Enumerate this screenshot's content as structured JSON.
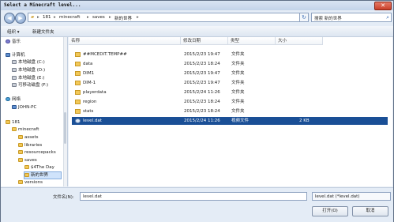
{
  "window": {
    "title": "Select a Minecraft level...",
    "close_glyph": "✕"
  },
  "address": {
    "back_glyph": "◀",
    "forward_glyph": "▶",
    "crumbs": [
      "181",
      "minecraft",
      "saves",
      "新的世界"
    ],
    "sep": "▸",
    "dropdown_glyph": "▾",
    "refresh_glyph": "↻",
    "search_placeholder": "搜索 新的世界",
    "search_glyph": "⌕"
  },
  "toolbar": {
    "organize": "组织 ▾",
    "new_folder": "新建文件夹"
  },
  "nav": {
    "items": [
      {
        "label": "音乐",
        "icon": "music-icon"
      },
      {
        "label": "计算机",
        "icon": "computer-icon"
      },
      {
        "label": "本地磁盘 (C:)",
        "icon": "drive-icon"
      },
      {
        "label": "本地磁盘 (D:)",
        "icon": "drive-icon"
      },
      {
        "label": "本地磁盘 (E:)",
        "icon": "drive-icon"
      },
      {
        "label": "可移动磁盘 (F:)",
        "icon": "drive-icon"
      },
      {
        "label": "网络",
        "icon": "network-icon"
      },
      {
        "label": "JOHN-PC",
        "icon": "computer-icon"
      },
      {
        "label": "181",
        "icon": "folder-icon"
      },
      {
        "label": "minecraft",
        "icon": "folder-icon"
      },
      {
        "label": "assets",
        "icon": "folder-icon"
      },
      {
        "label": "libraries",
        "icon": "folder-icon"
      },
      {
        "label": "resourcepacks",
        "icon": "folder-icon"
      },
      {
        "label": "saves",
        "icon": "folder-icon"
      },
      {
        "label": "$4The Day",
        "icon": "folder-icon"
      },
      {
        "label": "新的世界",
        "icon": "folder-icon"
      },
      {
        "label": "versions",
        "icon": "folder-icon"
      }
    ]
  },
  "columns": {
    "name": "名称",
    "date": "修改日期",
    "type": "类型",
    "size": "大小"
  },
  "files": [
    {
      "name": "##MCEDIT.TEMP##",
      "date": "2015/2/23 19:47",
      "type": "文件夹",
      "size": ""
    },
    {
      "name": "data",
      "date": "2015/2/23 18:24",
      "type": "文件夹",
      "size": ""
    },
    {
      "name": "DIM1",
      "date": "2015/2/23 19:47",
      "type": "文件夹",
      "size": ""
    },
    {
      "name": "DIM-1",
      "date": "2015/2/23 19:47",
      "type": "文件夹",
      "size": ""
    },
    {
      "name": "playerdata",
      "date": "2015/2/24 11:26",
      "type": "文件夹",
      "size": ""
    },
    {
      "name": "region",
      "date": "2015/2/23 18:24",
      "type": "文件夹",
      "size": ""
    },
    {
      "name": "stats",
      "date": "2015/2/23 18:24",
      "type": "文件夹",
      "size": ""
    },
    {
      "name": "level.dat",
      "date": "2015/2/24 11:26",
      "type": "视频文件",
      "size": "2 KB"
    }
  ],
  "bottom": {
    "filename_label": "文件名(N):",
    "filename_value": "level.dat",
    "filetype_value": "level.dat (*level.dat)",
    "open_label": "打开(O)",
    "cancel_label": "取消"
  }
}
